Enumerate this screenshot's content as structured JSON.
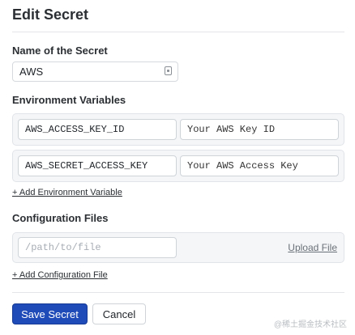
{
  "dialog": {
    "title": "Edit Secret"
  },
  "name": {
    "label": "Name of the Secret",
    "value": "AWS"
  },
  "env": {
    "label": "Environment Variables",
    "rows": [
      {
        "key": "AWS_ACCESS_KEY_ID",
        "value_placeholder": "Your AWS Key ID"
      },
      {
        "key": "AWS_SECRET_ACCESS_KEY",
        "value_placeholder": "Your AWS Access Key"
      }
    ],
    "add_link": "+ Add Environment Variable"
  },
  "files": {
    "label": "Configuration Files",
    "path_placeholder": "/path/to/file",
    "upload_link": "Upload File",
    "add_link": "+ Add Configuration File"
  },
  "actions": {
    "save_label": "Save Secret",
    "cancel_label": "Cancel"
  },
  "watermark": "@稀土掘金技术社区",
  "colors": {
    "primary": "#1f4bb8",
    "row_bg": "#f4f6f8"
  },
  "icons": {
    "name_field": "key-icon"
  }
}
